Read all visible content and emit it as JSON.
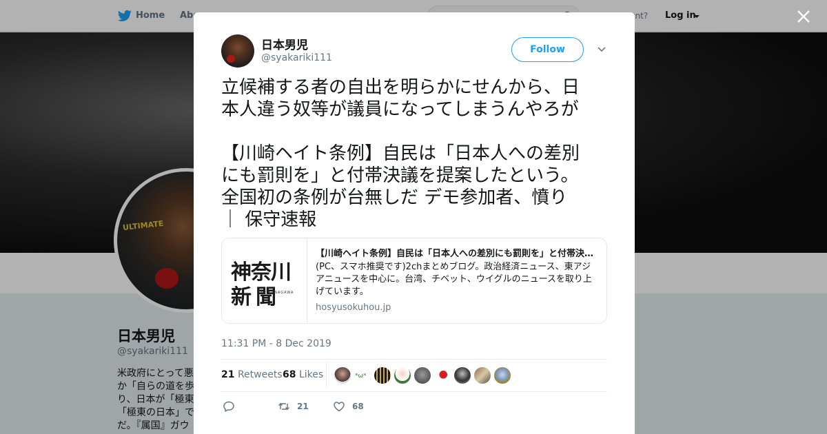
{
  "topnav": {
    "home_label": "Home",
    "about_label": "Abo",
    "have_account_text": "count?",
    "login_label": "Log in"
  },
  "profile": {
    "name": "日本男児",
    "handle": "@syakariki111",
    "bio_lines": [
      "米政府にとって悪",
      "か「自らの道を歩",
      "り、日本が「極東",
      "「極東の日本」で",
      "だ。『属国』ガウ"
    ]
  },
  "tweet": {
    "author_name": "日本男児",
    "author_handle": "@syakariki111",
    "follow_label": "Follow",
    "text_lines": [
      "立候補する者の自出を明らかにせんから、日",
      "本人違う奴等が議員になってしまうんやろが",
      "",
      "【川崎ヘイト条例】自民は「日本人への差別",
      "にも罰則を」と付帯決議を提案したという。",
      "全国初の条例が台無しだ デモ参加者、憤り",
      "｜ 保守速報"
    ],
    "card": {
      "thumb_line1": "神奈川",
      "thumb_line2": "新聞",
      "thumb_small": "THE KANAGAWA",
      "title": "【川崎ヘイト条例】自民は「日本人への差別にも罰則を」と付帯決議を提案したという。全国初の条例が台無しだ デモ参加者、憤り",
      "description": "(PC、スマホ推奨です)2chまとめブログ。政治経済ニュース、東アジアニュースを中心に。台湾、チベット、ウイグルのニュースを取り上げています。",
      "domain": "hosyusokuhou.jp"
    },
    "timestamp": "11:31 PM - 8 Dec 2019",
    "retweets_count": "21",
    "retweets_label": "Retweets",
    "likes_count": "68",
    "likes_label": "Likes",
    "action_retweets": "21",
    "action_likes": "68"
  },
  "colors": {
    "accent": "#1da1f2",
    "muted": "#657786",
    "text": "#14171a"
  },
  "icons": [
    "twitter-bird-icon",
    "search-icon",
    "close-icon",
    "chevron-down-icon",
    "reply-icon",
    "retweet-icon",
    "like-icon"
  ]
}
